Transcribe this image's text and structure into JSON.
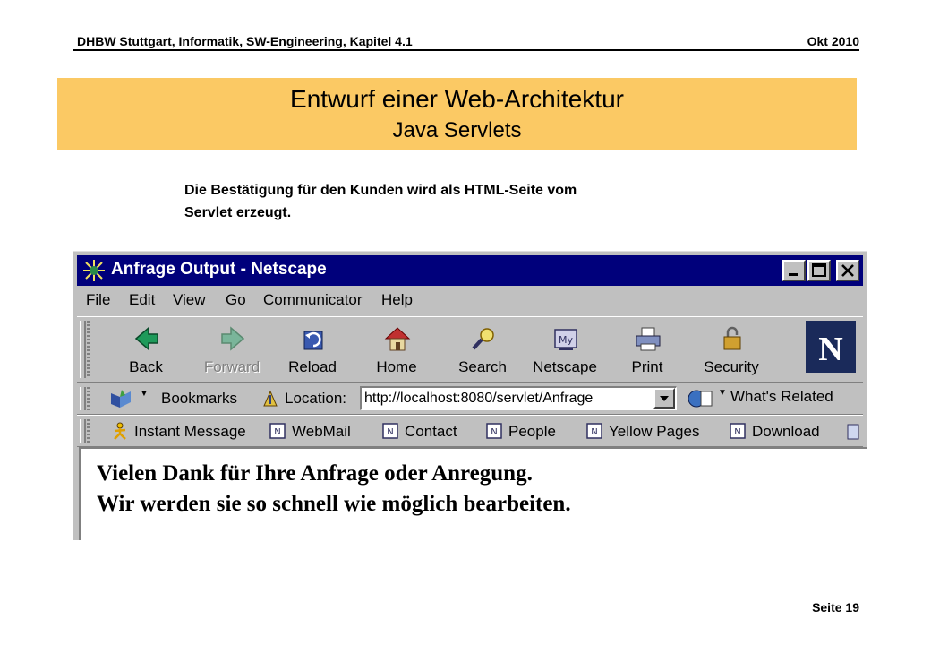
{
  "slide": {
    "header_left": "DHBW Stuttgart, Informatik, SW-Engineering, Kapitel 4.1",
    "header_right": "Okt 2010",
    "title": "Entwurf einer Web-Architektur",
    "subtitle": "Java Servlets",
    "intro_line1": "Die Bestätigung für den Kunden wird als HTML-Seite vom",
    "intro_line2": "Servlet erzeugt.",
    "footer": "Seite 19",
    "band_color": "#fbc964"
  },
  "window": {
    "title": "Anfrage Output - Netscape",
    "titlebar_color": "#00007b",
    "menu": [
      "File",
      "Edit",
      "View",
      "Go",
      "Communicator",
      "Help"
    ],
    "nav": [
      {
        "label": "Back",
        "icon": "back-arrow-icon",
        "enabled": true
      },
      {
        "label": "Forward",
        "icon": "forward-arrow-icon",
        "enabled": false
      },
      {
        "label": "Reload",
        "icon": "reload-icon",
        "enabled": true
      },
      {
        "label": "Home",
        "icon": "home-icon",
        "enabled": true
      },
      {
        "label": "Search",
        "icon": "search-icon",
        "enabled": true
      },
      {
        "label": "Netscape",
        "icon": "netscape-icon",
        "enabled": true
      },
      {
        "label": "Print",
        "icon": "print-icon",
        "enabled": true
      },
      {
        "label": "Security",
        "icon": "security-lock-icon",
        "enabled": true
      }
    ],
    "logo_letter": "N",
    "bookmarks_label": "Bookmarks",
    "location_label": "Location:",
    "url": "http://localhost:8080/servlet/Anfrage",
    "whats_related_label": "What's Related",
    "personal": [
      "Instant Message",
      "WebMail",
      "Contact",
      "People",
      "Yellow Pages",
      "Download"
    ],
    "content_line1": "Vielen Dank für Ihre Anfrage oder Anregung.",
    "content_line2": "Wir werden sie so schnell wie möglich bearbeiten."
  }
}
